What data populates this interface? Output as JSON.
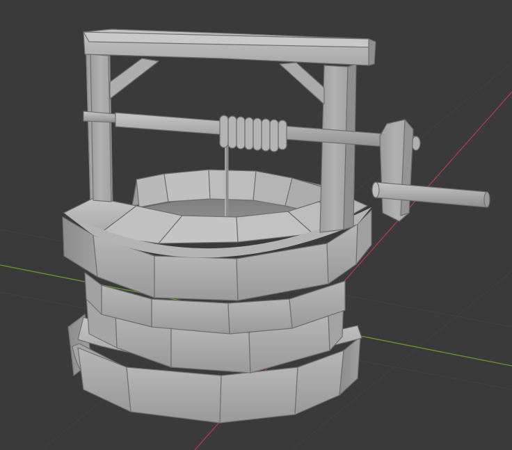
{
  "viewport": {
    "background": "#3a3a3a",
    "grid_color": "#414141",
    "x_axis_color": "#b33a4c",
    "y_axis_color": "#6a9a26",
    "model_name": "stone-well",
    "model_base_color": "#a9a9a9"
  }
}
